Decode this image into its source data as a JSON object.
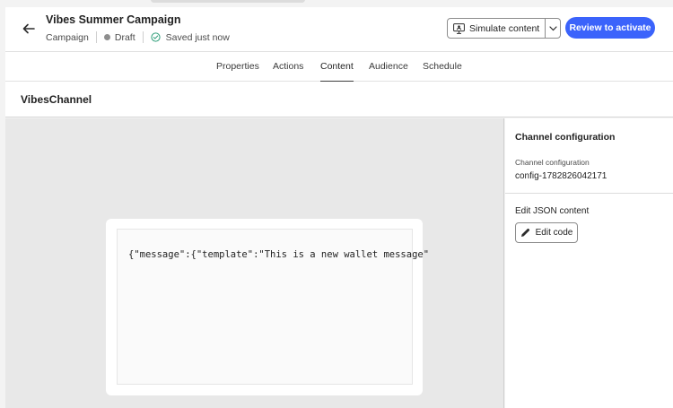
{
  "header": {
    "title": "Vibes Summer Campaign",
    "type": "Campaign",
    "status": "Draft",
    "saved": "Saved just now",
    "simulate_label": "Simulate content",
    "review_label": "Review to activate",
    "accent_color": "#3b63fb"
  },
  "tabs": [
    {
      "label": "Properties",
      "active": false
    },
    {
      "label": "Actions",
      "active": false
    },
    {
      "label": "Content",
      "active": true
    },
    {
      "label": "Audience",
      "active": false
    },
    {
      "label": "Schedule",
      "active": false
    }
  ],
  "section": {
    "title": "VibesChannel"
  },
  "editor": {
    "code": "{\"message\":{\"template\":\"This is a new wallet message\""
  },
  "panel": {
    "heading": "Channel configuration",
    "config_label": "Channel configuration",
    "config_value": "config-1782826042171",
    "json_heading": "Edit JSON content",
    "edit_code_label": "Edit code"
  }
}
